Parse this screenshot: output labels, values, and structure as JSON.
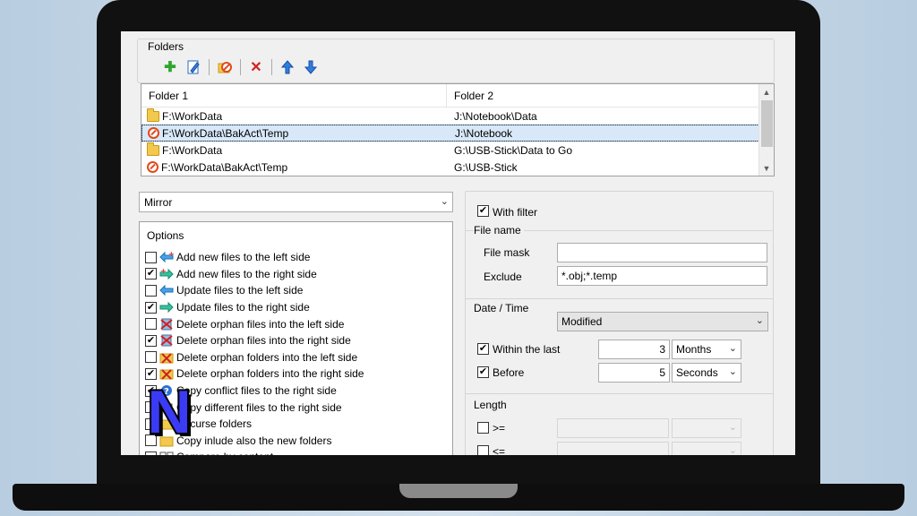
{
  "folders": {
    "legend": "Folders",
    "toolbar": [
      "add-icon",
      "edit-icon",
      "exclude-icon",
      "delete-icon",
      "up-arrow-icon",
      "down-arrow-icon"
    ],
    "columns": [
      "Folder 1",
      "Folder 2"
    ],
    "rows": [
      {
        "folder1": "F:\\WorkData",
        "folder2": "J:\\Notebook\\Data",
        "icon": "folder-icon",
        "selected": false
      },
      {
        "folder1": "F:\\WorkData\\BakAct\\Temp",
        "folder2": "J:\\Notebook",
        "icon": "no-entry-icon",
        "selected": true
      },
      {
        "folder1": "F:\\WorkData",
        "folder2": "G:\\USB-Stick\\Data to Go",
        "icon": "folder-icon",
        "selected": false
      },
      {
        "folder1": "F:\\WorkData\\BakAct\\Temp",
        "folder2": "G:\\USB-Stick",
        "icon": "no-entry-icon",
        "selected": false
      }
    ]
  },
  "mode": {
    "value": "Mirror"
  },
  "options": {
    "title": "Options",
    "items": [
      {
        "label": "Add new files to the left side",
        "checked": false,
        "icon": "arrow-left-plus-icon"
      },
      {
        "label": "Add new files to the right side",
        "checked": true,
        "icon": "arrow-right-plus-icon"
      },
      {
        "label": "Update files to the left side",
        "checked": false,
        "icon": "arrow-left-icon"
      },
      {
        "label": "Update files to the right side",
        "checked": true,
        "icon": "arrow-right-icon"
      },
      {
        "label": "Delete orphan files into the left side",
        "checked": false,
        "icon": "delete-file-left-icon"
      },
      {
        "label": "Delete orphan files into the right side",
        "checked": true,
        "icon": "delete-file-right-icon"
      },
      {
        "label": "Delete orphan folders into the left side",
        "checked": false,
        "icon": "delete-folder-left-icon"
      },
      {
        "label": "Delete orphan folders into the right side",
        "checked": true,
        "icon": "delete-folder-right-icon"
      },
      {
        "label": "Copy conflict files to the right side",
        "checked": true,
        "icon": "question-icon"
      },
      {
        "label": "Copy different files to the right side",
        "checked": false,
        "icon": "copy-icon"
      },
      {
        "label": "Recurse folders",
        "checked": false,
        "icon": "recurse-icon"
      },
      {
        "label": "Copy inlude also the new folders",
        "checked": false,
        "icon": "folder-icon"
      },
      {
        "label": "Compare by content",
        "checked": false,
        "icon": "compare-icon"
      }
    ]
  },
  "filter": {
    "with_filter": {
      "label": "With filter",
      "checked": true
    },
    "file_name": {
      "title": "File name",
      "mask_label": "File mask",
      "mask_value": "",
      "exclude_label": "Exclude",
      "exclude_value": "*.obj;*.temp"
    },
    "datetime": {
      "title": "Date / Time",
      "type": "Modified",
      "within": {
        "label": "Within the last",
        "checked": true,
        "value": "3",
        "unit": "Months"
      },
      "before": {
        "label": "Before",
        "checked": true,
        "value": "5",
        "unit": "Seconds"
      }
    },
    "length": {
      "title": "Length",
      "ge_label": ">=",
      "le_label": "<="
    }
  },
  "badge": {
    "letter": "N"
  }
}
